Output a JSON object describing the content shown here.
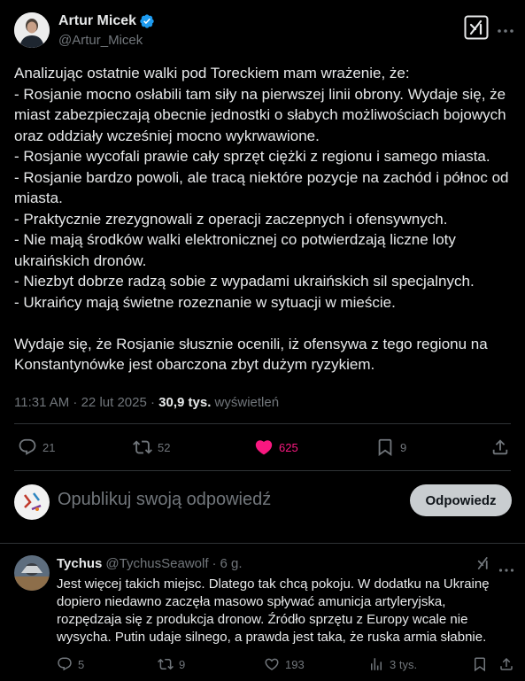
{
  "main_post": {
    "author_name": "Artur Micek",
    "author_handle": "@Artur_Micek",
    "text": "Analizując ostatnie walki pod Toreckiem mam wrażenie, że:\n- Rosjanie mocno osłabili tam siły na pierwszej linii obrony. Wydaje się, że miast zabezpieczają obecnie jednostki o słabych możliwościach bojowych oraz oddziały wcześniej mocno wykrwawione.\n- Rosjanie wycofali prawie cały sprzęt ciężki z regionu i samego miasta.\n- Rosjanie bardzo powoli, ale tracą niektóre pozycje na zachód i północ od miasta.\n- Praktycznie zrezygnowali z operacji zaczepnych i ofensywnych.\n- Nie mają środków walki elektronicznej co potwierdzają liczne loty ukraińskich dronów.\n- Niezbyt dobrze radzą sobie z wypadami ukraińskich sil specjalnych.\n- Ukraińcy mają świetne rozeznanie w sytuacji w mieście.\n\nWydaje się, że Rosjanie słusznie ocenili, iż ofensywa z tego regionu na Konstantynówke jest obarczona zbyt dużym ryzykiem.",
    "time": "11:31 AM · 22 lut 2025 · ",
    "views_count": "30,9 tys.",
    "views_label": " wyświetleń",
    "replies": "21",
    "reposts": "52",
    "likes": "625",
    "bookmarks": "9"
  },
  "compose": {
    "placeholder": "Opublikuj swoją odpowiedź",
    "button": "Odpowiedz"
  },
  "reply_post": {
    "author_name": "Tychus",
    "author_handle": "@TychusSeawolf",
    "separator": "·",
    "age": "6 g.",
    "text": "Jest więcej takich miejsc. Dlatego tak chcą pokoju. W dodatku na Ukrainę dopiero niedawno zaczęła masowo spływać amunicja artyleryjska, rozpędzaja się z produkcja dronow. Źródło sprzętu z Europy wcale nie wysycha. Putin udaje silnego, a prawda jest taka, że ruska armia słabnie.",
    "replies": "5",
    "reposts": "9",
    "likes": "193",
    "views": "3 tys."
  },
  "colors": {
    "background": "#000000",
    "text": "#e7e9ea",
    "muted": "#71767b",
    "like_active": "#f91880",
    "verified": "#1d9bf0",
    "button_bg": "#c9cdd0"
  },
  "icons": [
    "verified-badge-icon",
    "grok-icon",
    "more-icon",
    "reply-icon",
    "repost-icon",
    "like-icon",
    "bookmark-icon",
    "share-icon"
  ]
}
